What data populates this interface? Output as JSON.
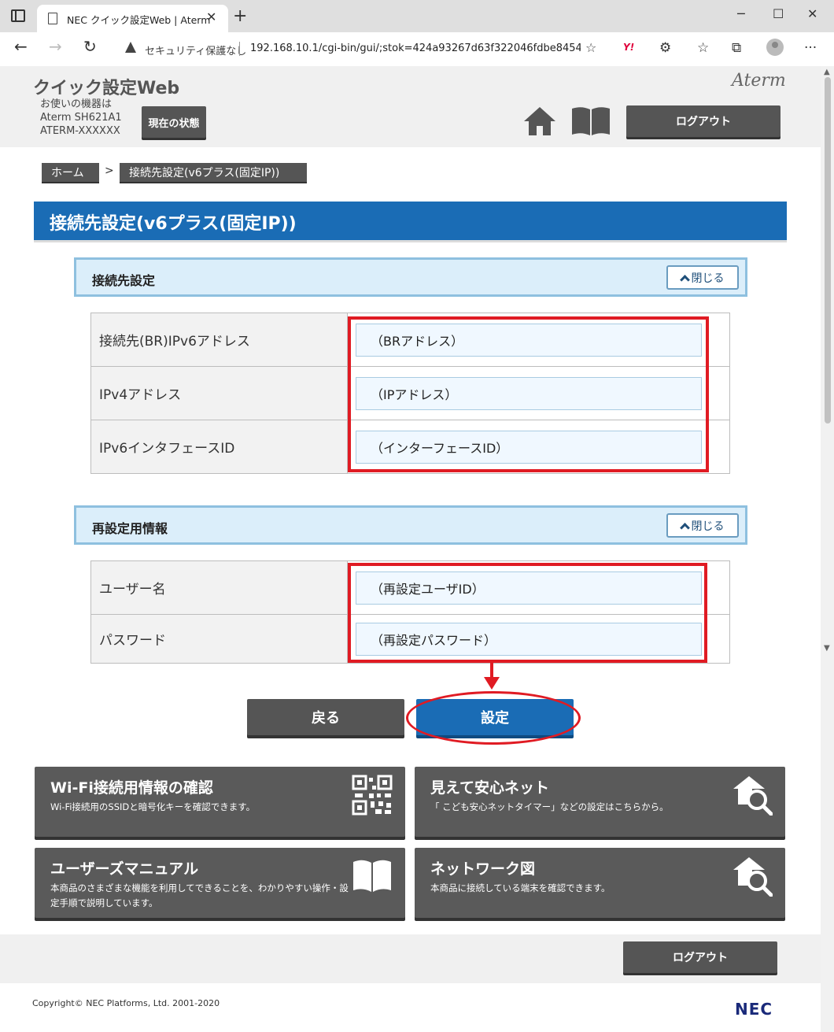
{
  "browser": {
    "tab_title": "NEC クイック設定Web | Aterm",
    "tab_close": "✕",
    "new_tab": "+",
    "minimize": "─",
    "maximize": "☐",
    "close_window": "✕",
    "back": "←",
    "forward": "→",
    "reload": "↻",
    "security_text": "セキュリティ保護なし",
    "url": "192.168.10.1/cgi-bin/gui/;stok=424a93267d63f322046fdbe8454c...",
    "yahoo_label": "Y!",
    "extensions_icon": "⚙",
    "favorites_icon": "☆",
    "collections_icon": "⧉",
    "more": "···"
  },
  "header": {
    "app_title": "クイック設定Web",
    "device_lines": [
      "お使いの機器は",
      "Aterm SH621A1",
      "ATERM-XXXXXX"
    ],
    "status_button": "現在の状態",
    "brand": "Aterm",
    "logout": "ログアウト"
  },
  "breadcrumb": {
    "home": "ホーム",
    "separator": ">",
    "current": "接続先設定(v6プラス(固定IP))"
  },
  "page_title": "接続先設定(v6プラス(固定IP))",
  "sections": {
    "connection": {
      "title": "接続先設定",
      "close_label": "閉じる",
      "rows": [
        {
          "label": "接続先(BR)IPv6アドレス",
          "value": "（BRアドレス）"
        },
        {
          "label": "IPv4アドレス",
          "value": "（IPアドレス）"
        },
        {
          "label": "IPv6インタフェースID",
          "value": "（インターフェースID）"
        }
      ]
    },
    "reset": {
      "title": "再設定用情報",
      "close_label": "閉じる",
      "rows": [
        {
          "label": "ユーザー名",
          "value": "（再設定ユーザID）"
        },
        {
          "label": "パスワード",
          "value": "（再設定パスワード）"
        }
      ]
    }
  },
  "actions": {
    "back": "戻る",
    "submit": "設定"
  },
  "tiles": [
    {
      "title": "Wi-Fi接続用情報の確認",
      "desc": "Wi-Fi接続用のSSIDと暗号化キーを確認できます。",
      "icon": "qr-code-icon"
    },
    {
      "title": "見えて安心ネット",
      "desc": "「 こども安心ネットタイマー」などの設定はこちらから。",
      "icon": "home-search-icon"
    },
    {
      "title": "ユーザーズマニュアル",
      "desc": "本商品のさまざまな機能を利用してできることを、わかりやすい操作・設定手順で説明しています。",
      "icon": "book-icon"
    },
    {
      "title": "ネットワーク図",
      "desc": "本商品に接続している端末を確認できます。",
      "icon": "home-search-icon"
    }
  ],
  "footer": {
    "logout": "ログアウト",
    "copyright": "Copyright© NEC Platforms, Ltd. 2001-2020",
    "logo": "NEC"
  },
  "colors": {
    "title_bar": "#1a6cb5",
    "dark_button": "#555555",
    "annotation_red": "#e01b23",
    "section_head_bg": "#dbeefa"
  }
}
